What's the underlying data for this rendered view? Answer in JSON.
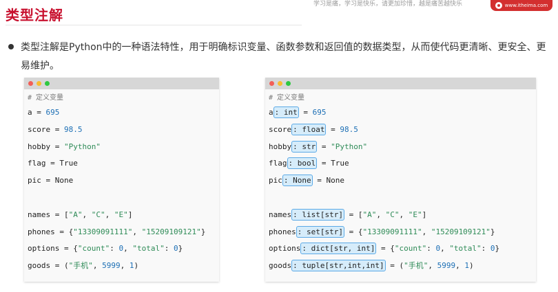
{
  "page": {
    "title": "类型注解",
    "top_note": "学习是痛，学习是快乐，请更加珍惜，越是痛苦越快乐",
    "brand": "www.itheima.com",
    "bullet": "类型注解是Python中的一种语法特性，用于明确标识变量、函数参数和返回值的数据类型，从而使代码更清晰、更安全、更易维护。"
  },
  "colors": {
    "title": "#c8102e",
    "number": "#1c6fb5",
    "string": "#2e8b57",
    "hint_bg": "#d6ecfa",
    "hint_border": "#5aa9e6"
  },
  "left_code": {
    "comment": "# 定义变量",
    "a": {
      "name": "a",
      "op": " = ",
      "value": "695"
    },
    "score": {
      "name": "score",
      "op": " = ",
      "value": "98.5"
    },
    "hobby": {
      "name": "hobby",
      "op": " = ",
      "value": "\"Python\""
    },
    "flag": {
      "name": "flag",
      "op": " = ",
      "value": "True"
    },
    "pic": {
      "name": "pic",
      "op": " = ",
      "value": "None"
    },
    "names": {
      "name": "names",
      "pre": " = [",
      "v1": "\"A\"",
      "s1": ", ",
      "v2": "\"C\"",
      "s2": ", ",
      "v3": "\"E\"",
      "post": "]"
    },
    "phones": {
      "name": "phones",
      "pre": " = {",
      "v1": "\"13309091111\"",
      "s1": ", ",
      "v2": "\"15209109121\"",
      "post": "}"
    },
    "options": {
      "name": "options",
      "pre": " = {",
      "k1": "\"count\"",
      "m1": ": ",
      "n1": "0",
      "s1": ", ",
      "k2": "\"total\"",
      "m2": ": ",
      "n2": "0",
      "post": "}"
    },
    "goods": {
      "name": "goods",
      "pre": " = (",
      "v1": "\"手机\"",
      "s1": ", ",
      "n1": "5999",
      "s2": ", ",
      "n2": "1",
      "post": ")"
    }
  },
  "right_code": {
    "comment": "# 定义变量",
    "a": {
      "name": "a",
      "hint": ": int",
      "op": " = ",
      "value": "695"
    },
    "score": {
      "name": "score",
      "hint": ": float",
      "op": " = ",
      "value": "98.5"
    },
    "hobby": {
      "name": "hobby",
      "hint": ": str",
      "op": " = ",
      "value": "\"Python\""
    },
    "flag": {
      "name": "flag",
      "hint": ": bool",
      "op": " = ",
      "value": "True"
    },
    "pic": {
      "name": "pic",
      "hint": ": None",
      "op": " = ",
      "value": "None"
    },
    "names": {
      "name": "names",
      "hint": ": list[str]",
      "pre": " = [",
      "v1": "\"A\"",
      "s1": ", ",
      "v2": "\"C\"",
      "s2": ", ",
      "v3": "\"E\"",
      "post": "]"
    },
    "phones": {
      "name": "phones",
      "hint": ": set[str]",
      "pre": " = {",
      "v1": "\"13309091111\"",
      "s1": ", ",
      "v2": "\"15209109121\"",
      "post": "}"
    },
    "options": {
      "name": "options",
      "hint": ": dict[str, int]",
      "pre": " = {",
      "k1": "\"count\"",
      "m1": ": ",
      "n1": "0",
      "s1": ", ",
      "k2": "\"total\"",
      "m2": ": ",
      "n2": "0",
      "post": "}"
    },
    "goods": {
      "name": "goods",
      "hint": ": tuple[str,int,int]",
      "pre": " = (",
      "v1": "\"手机\"",
      "s1": ", ",
      "n1": "5999",
      "s2": ", ",
      "n2": "1",
      "post": ")"
    }
  }
}
